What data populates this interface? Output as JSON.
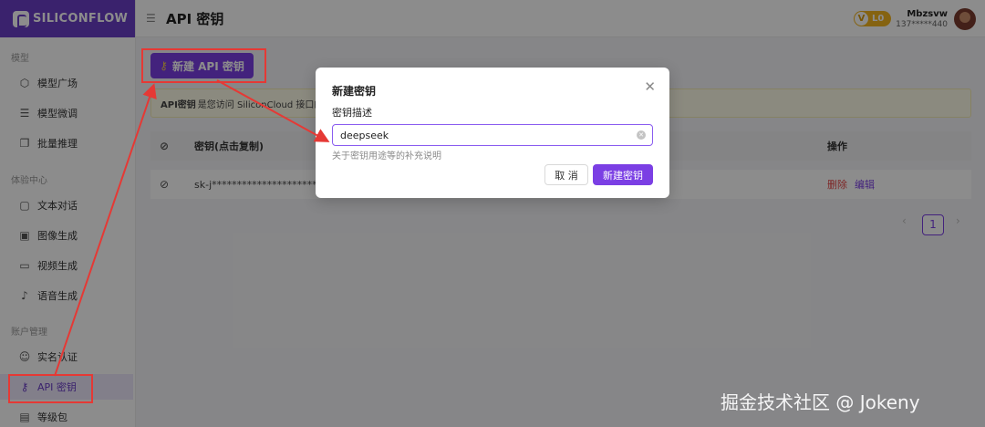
{
  "brand": {
    "name": "SILICONFLOW"
  },
  "sidebar": {
    "sections": [
      {
        "title": "模型",
        "items": [
          {
            "label": "模型广场"
          },
          {
            "label": "模型微调"
          },
          {
            "label": "批量推理"
          }
        ]
      },
      {
        "title": "体验中心",
        "items": [
          {
            "label": "文本对话"
          },
          {
            "label": "图像生成"
          },
          {
            "label": "视频生成"
          },
          {
            "label": "语音生成"
          }
        ]
      },
      {
        "title": "账户管理",
        "items": [
          {
            "label": "实名认证"
          },
          {
            "label": "API 密钥",
            "active": true
          },
          {
            "label": "等级包"
          }
        ]
      }
    ]
  },
  "header": {
    "title": "API 密钥",
    "vip_badge": "V",
    "vip_level": "L0",
    "username": "Mbzsvw",
    "phone": "137*****440"
  },
  "main": {
    "create_button": "新建 API 密钥",
    "info_text_1": "API密钥",
    "info_text_2": "是您访问 SiliconCloud 接口的",
    "table": {
      "col_key": "密钥(点击复制)",
      "col_ops": "操作",
      "rows": [
        {
          "key": "sk-j***************************",
          "delete": "删除",
          "edit": "编辑"
        }
      ]
    },
    "pagination": {
      "prev": "‹",
      "current": "1",
      "next": "›"
    }
  },
  "modal": {
    "title": "新建密钥",
    "field_label": "密钥描述",
    "field_value": "deepseek",
    "help_text": "关于密钥用途等的补充说明",
    "cancel_label": "取 消",
    "confirm_label": "新建密钥"
  },
  "watermark": "掘金技术社区 @ Jokeny",
  "colors": {
    "brand": "#6b3fc7",
    "primary": "#7b3fe4",
    "danger": "#e54545",
    "annotation": "#e53935"
  },
  "icons": {
    "cube": "cube-icon",
    "tune": "sliders-icon",
    "batch": "batch-icon",
    "chat": "chat-icon",
    "image": "image-icon",
    "video": "video-icon",
    "mic": "mic-icon",
    "user": "user-check-icon",
    "key": "key-icon",
    "package": "package-icon",
    "eye": "eye-off-icon",
    "close": "close-icon",
    "clear": "clear-icon"
  }
}
